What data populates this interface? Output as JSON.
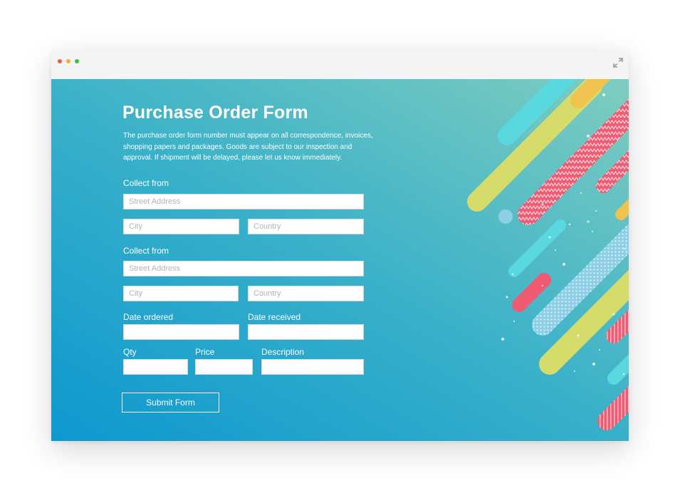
{
  "window": {
    "controls": [
      {
        "name": "close",
        "color": "#ef5b3c"
      },
      {
        "name": "minimize",
        "color": "#f6b125"
      },
      {
        "name": "maximize",
        "color": "#36c340"
      }
    ],
    "expand_icon": "expand-arrows-icon"
  },
  "form": {
    "title": "Purchase Order Form",
    "intro": "The purchase order form number must appear on all correspondence, invoices, shopping papers and packages. Goods are subject to our inspection and approval. If shipment will be delayed, please let us know immediately.",
    "address_block_1": {
      "label": "Collect from",
      "street_placeholder": "Street Address",
      "city_placeholder": "City",
      "country_placeholder": "Country"
    },
    "address_block_2": {
      "label": "Collect from",
      "street_placeholder": "Street Address",
      "city_placeholder": "City",
      "country_placeholder": "Country"
    },
    "dates": {
      "ordered_label": "Date ordered",
      "received_label": "Date received"
    },
    "item": {
      "qty_label": "Qty",
      "price_label": "Price",
      "description_label": "Description"
    },
    "submit_label": "Submit Form"
  },
  "colors": {
    "background_start": "#0d98d0",
    "background_end": "#7fcdbf",
    "text": "#ffffff",
    "art": [
      "#5ad8e0",
      "#d6dc6a",
      "#ee5b73",
      "#f0c24f",
      "#8ecfe8"
    ]
  }
}
